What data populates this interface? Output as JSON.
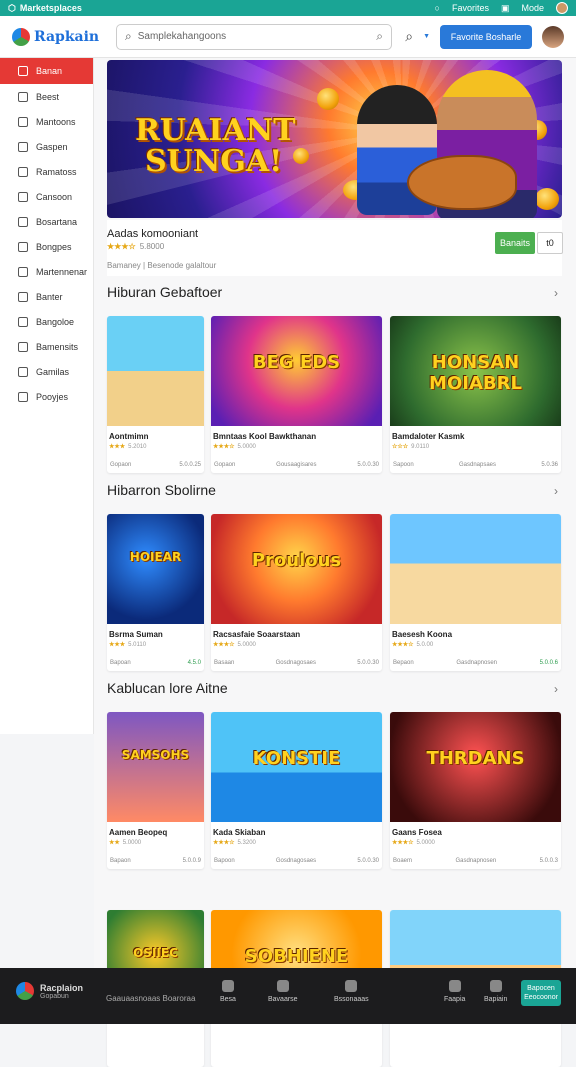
{
  "topbar": {
    "brand": "Marketsplaces",
    "items": [
      "Favorites",
      "Mode"
    ]
  },
  "header": {
    "logo_text": "Rapkain",
    "search_placeholder": "Samplekahangoons",
    "cta_label": "Favorite Bosharle"
  },
  "sidebar": {
    "items": [
      {
        "label": "Banan",
        "active": true
      },
      {
        "label": "Beest"
      },
      {
        "label": "Mantoons"
      },
      {
        "label": "Gaspen"
      },
      {
        "label": "Ramatoss"
      },
      {
        "label": "Cansoon"
      },
      {
        "label": "Bosartana"
      },
      {
        "label": "Bongpes"
      },
      {
        "label": "Martennenar"
      },
      {
        "label": "Banter"
      },
      {
        "label": "Bangoloe"
      },
      {
        "label": "Bamensits"
      },
      {
        "label": "Gamilas"
      },
      {
        "label": "Pooyjes"
      }
    ]
  },
  "hero": {
    "title_line1": "RUAIANT",
    "title_line2": "SUNGA!",
    "game_title": "Aadas komooniant",
    "rating_stars": "★★★☆",
    "rating_text": "5.8000",
    "meta": "Bamaney | Besenode galaltour",
    "primary_btn": "Banaits",
    "secondary_btn": "t0"
  },
  "sections": [
    {
      "title": "Hiburan Gebaftoer",
      "cards": [
        {
          "title": "Aontmimn",
          "stars": "★★★",
          "rating": "5.2010",
          "left": "Gopaon",
          "right": "5.0.0.25",
          "thumb_text": ""
        },
        {
          "title": "Bmntaas Kool Bawkthanan",
          "stars": "★★★☆",
          "rating": "5.0000",
          "left": "Gopaon",
          "mid": "Gousaagisares",
          "right": "5.0.0.30",
          "thumb_text": "BEG EDS"
        },
        {
          "title": "Bamdaloter Kasmk",
          "stars": "☆☆☆",
          "rating": "9.0110",
          "left": "Sapoon",
          "mid": "Gasdnapsaes",
          "right": "5.0.36",
          "thumb_text": "HONSAN MOIABRL"
        }
      ]
    },
    {
      "title": "Hibarron Sbolirne",
      "cards": [
        {
          "title": "Bsrma Suman",
          "stars": "★★★",
          "rating": "5.0110",
          "left": "Bapoan",
          "right": "4.5.0",
          "right_green": true,
          "thumb_text": "HOIEAR"
        },
        {
          "title": "Racsasfaie Soaarstaan",
          "stars": "★★★☆",
          "rating": "5.0000",
          "left": "Basaan",
          "mid": "Gosdnagosaes",
          "right": "5.0.0.30",
          "thumb_text": "Proulous"
        },
        {
          "title": "Baesesh Koona",
          "stars": "★★★☆",
          "rating": "5.0.00",
          "left": "Bepaon",
          "mid": "Gasdnapnosen",
          "right": "5.0.0.6",
          "right_green": true,
          "thumb_text": ""
        }
      ]
    },
    {
      "title": "Kablucan lore Aitne",
      "cards": [
        {
          "title": "Aamen Beopeq",
          "stars": "★★",
          "rating": "5.0000",
          "left": "Bapaon",
          "right": "5.0.0.9",
          "thumb_text": "SAMSOHS"
        },
        {
          "title": "Kada Skiaban",
          "stars": "★★★☆",
          "rating": "5.3200",
          "left": "Bapoon",
          "mid": "Gosdnagosaes",
          "right": "5.0.0.30",
          "thumb_text": "KONSTIE"
        },
        {
          "title": "Gaans Fosea",
          "stars": "★★★☆",
          "rating": "5.0000",
          "left": "Boaem",
          "mid": "Gasdnapnosen",
          "right": "5.0.0.3",
          "thumb_text": "THRDANS"
        }
      ]
    },
    {
      "title": "",
      "cards": [
        {
          "title": "",
          "thumb_text": "OSIIEC"
        },
        {
          "title": "",
          "thumb_text": "SOBHIENE"
        },
        {
          "title": "",
          "thumb_text": ""
        }
      ]
    }
  ],
  "bottombar": {
    "logo_title": "Racplaion",
    "logo_sub": "Gopabun",
    "text": "Gaauaasnoaas Boaroraa",
    "nav": [
      "Besa",
      "Bavaarse",
      "Bssonaaas",
      "Faapia",
      "Bapiain"
    ],
    "btn_line1": "Bapocen",
    "btn_line2": "Eeocoonor"
  }
}
